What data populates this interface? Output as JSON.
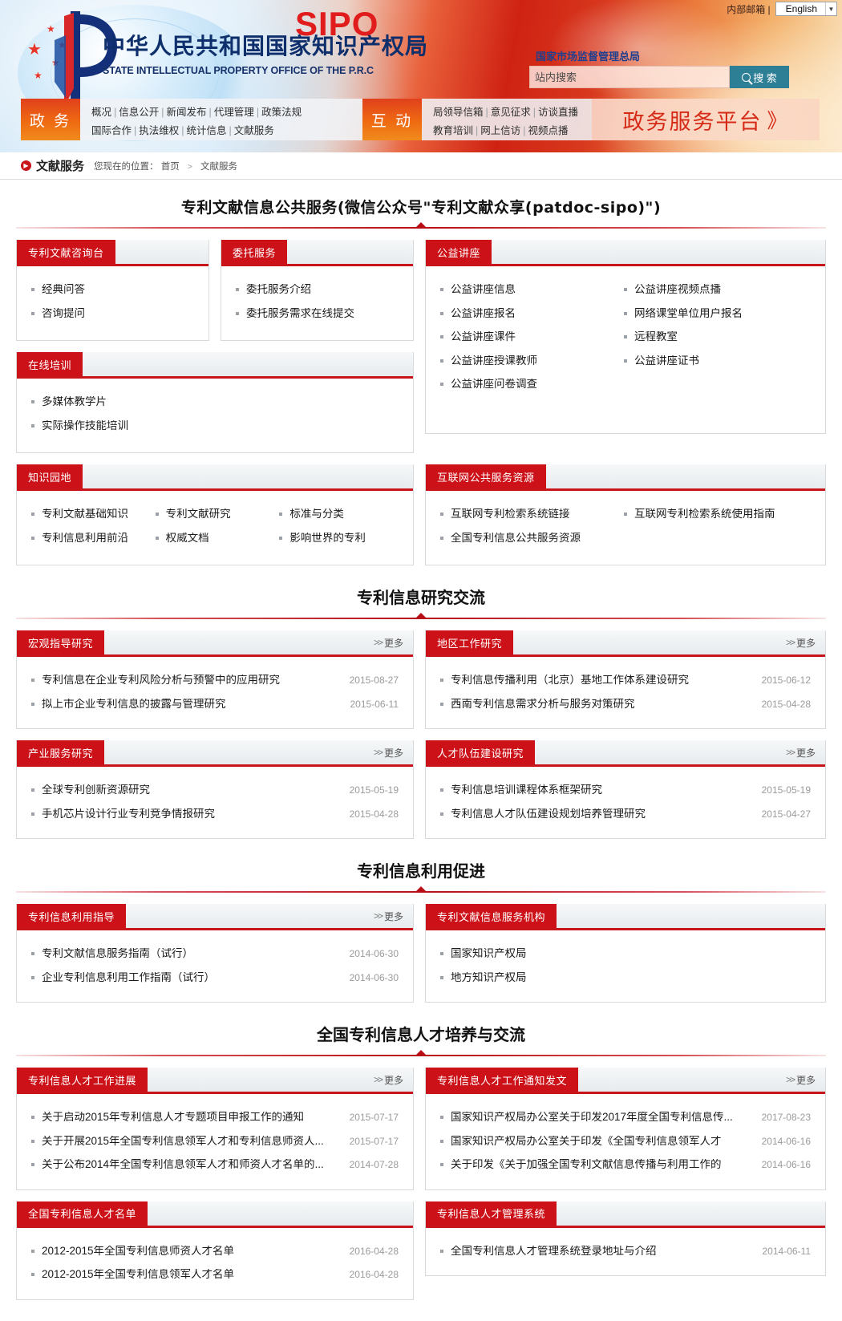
{
  "header": {
    "top_mail_label": "内部邮箱 |",
    "language": "English",
    "logo_cn": "中华人民共和国国家知识产权局",
    "logo_en": "STATE INTELLECTUAL PROPERTY OFFICE OF THE P.R.C",
    "sipo": "SIPO",
    "agency": "国家市场监督管理总局",
    "search_placeholder": "站内搜索",
    "search_value": "",
    "search_button": "搜 索"
  },
  "nav": {
    "gov_badge": "政 务",
    "gov_links_row1": [
      "概况",
      "信息公开",
      "新闻发布",
      "代理管理",
      "政策法规"
    ],
    "gov_links_row2": [
      "国际合作",
      "执法维权",
      "统计信息",
      "文献服务"
    ],
    "inter_badge": "互 动",
    "inter_links_row1": [
      "局领导信箱",
      "意见征求",
      "访谈直播"
    ],
    "inter_links_row2": [
      "教育培训",
      "网上信访",
      "视频点播"
    ],
    "platform": "政务服务平台",
    "platform_chevron": "》"
  },
  "breadcrumb": {
    "title": "文献服务",
    "prefix": "您现在的位置：",
    "home": "首页",
    "current": "文献服务"
  },
  "page": {
    "title": "专利文献信息公共服务(微信公众号\"专利文献众享(patdoc-sipo)\")",
    "more_label": "更多",
    "more_prefix": "》"
  },
  "block1": {
    "consult": {
      "title": "专利文献咨询台",
      "items": [
        "经典问答",
        "咨询提问"
      ]
    },
    "entrust": {
      "title": "委托服务",
      "items": [
        "委托服务介绍",
        "委托服务需求在线提交"
      ]
    },
    "training": {
      "title": "在线培训",
      "items": [
        "多媒体教学片",
        "实际操作技能培训"
      ]
    },
    "lecture": {
      "title": "公益讲座",
      "items_col1": [
        "公益讲座信息",
        "公益讲座报名",
        "公益讲座课件",
        "公益讲座授课教师",
        "公益讲座问卷调查"
      ],
      "items_col2": [
        "公益讲座视频点播",
        "网络课堂单位用户报名",
        "远程教室",
        "公益讲座证书"
      ]
    },
    "knowledge": {
      "title": "知识园地",
      "items": [
        "专利文献基础知识",
        "专利文献研究",
        "标准与分类",
        "专利信息利用前沿",
        "权威文档",
        "影响世界的专利"
      ]
    },
    "internet": {
      "title": "互联网公共服务资源",
      "items_col1": [
        "互联网专利检索系统链接",
        "全国专利信息公共服务资源"
      ],
      "items_col2": [
        "互联网专利检索系统使用指南"
      ]
    }
  },
  "section_research": {
    "heading": "专利信息研究交流",
    "cards": [
      {
        "title": "宏观指导研究",
        "more": "更多",
        "items": [
          {
            "text": "专利信息在企业专利风险分析与预警中的应用研究",
            "date": "2015-08-27"
          },
          {
            "text": "拟上市企业专利信息的披露与管理研究",
            "date": "2015-06-11"
          }
        ]
      },
      {
        "title": "地区工作研究",
        "more": "更多",
        "items": [
          {
            "text": "专利信息传播利用（北京）基地工作体系建设研究",
            "date": "2015-06-12"
          },
          {
            "text": "西南专利信息需求分析与服务对策研究",
            "date": "2015-04-28"
          }
        ]
      },
      {
        "title": "产业服务研究",
        "more": "更多",
        "items": [
          {
            "text": "全球专利创新资源研究",
            "date": "2015-05-19"
          },
          {
            "text": "手机芯片设计行业专利竞争情报研究",
            "date": "2015-04-28"
          }
        ]
      },
      {
        "title": "人才队伍建设研究",
        "more": "更多",
        "items": [
          {
            "text": "专利信息培训课程体系框架研究",
            "date": "2015-05-19"
          },
          {
            "text": "专利信息人才队伍建设规划培养管理研究",
            "date": "2015-04-27"
          }
        ]
      }
    ]
  },
  "section_utilize": {
    "heading": "专利信息利用促进",
    "cards": [
      {
        "title": "专利信息利用指导",
        "more": "更多",
        "items": [
          {
            "text": "专利文献信息服务指南（试行）",
            "date": "2014-06-30"
          },
          {
            "text": "企业专利信息利用工作指南（试行）",
            "date": "2014-06-30"
          }
        ]
      },
      {
        "title": "专利文献信息服务机构",
        "more": "",
        "items": [
          {
            "text": "国家知识产权局",
            "date": ""
          },
          {
            "text": "地方知识产权局",
            "date": ""
          }
        ]
      }
    ]
  },
  "section_talent": {
    "heading": "全国专利信息人才培养与交流",
    "cards": [
      {
        "title": "专利信息人才工作进展",
        "more": "更多",
        "items": [
          {
            "text": "关于启动2015年专利信息人才专题项目申报工作的通知",
            "date": "2015-07-17"
          },
          {
            "text": "关于开展2015年全国专利信息领军人才和专利信息师资人...",
            "date": "2015-07-17"
          },
          {
            "text": "关于公布2014年全国专利信息领军人才和师资人才名单的...",
            "date": "2014-07-28"
          }
        ]
      },
      {
        "title": "专利信息人才工作通知发文",
        "more": "更多",
        "items": [
          {
            "text": "国家知识产权局办公室关于印发2017年度全国专利信息传...",
            "date": "2017-08-23"
          },
          {
            "text": "国家知识产权局办公室关于印发《全国专利信息领军人才",
            "date": "2014-06-16"
          },
          {
            "text": "关于印发《关于加强全国专利文献信息传播与利用工作的",
            "date": "2014-06-16"
          }
        ]
      },
      {
        "title": "全国专利信息人才名单",
        "more": "",
        "items": [
          {
            "text": "2012-2015年全国专利信息师资人才名单",
            "date": "2016-04-28"
          },
          {
            "text": "2012-2015年全国专利信息领军人才名单",
            "date": "2016-04-28"
          }
        ]
      },
      {
        "title": "专利信息人才管理系统",
        "more": "",
        "items": [
          {
            "text": "全国专利信息人才管理系统登录地址与介绍",
            "date": "2014-06-11"
          }
        ]
      }
    ]
  },
  "colors": {
    "brand_red": "#cc1118",
    "accent_red": "#c8141b",
    "orange": "#ef6a12",
    "nav_gray": "#f0f3f6",
    "date_gray": "#9b9b9b"
  }
}
